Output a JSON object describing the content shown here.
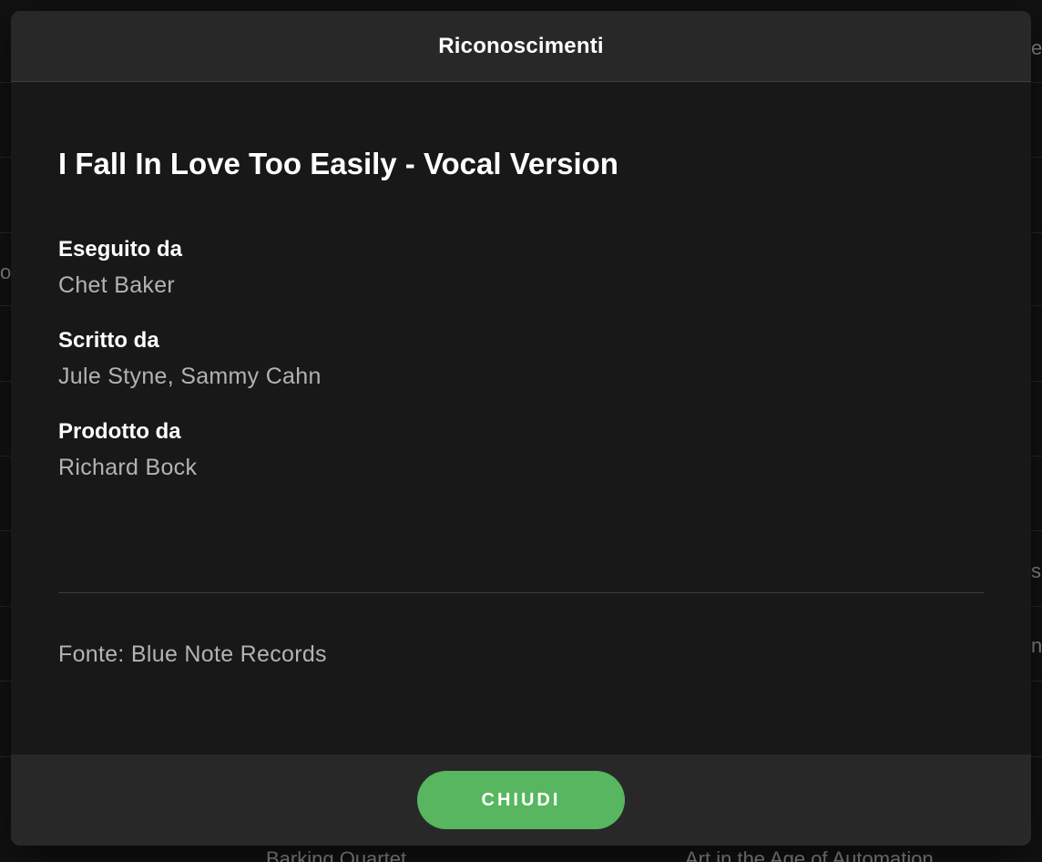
{
  "modal": {
    "title": "Riconoscimenti",
    "track_title": "I Fall In Love Too Easily - Vocal Version",
    "credits": [
      {
        "role": "Eseguito da",
        "names": "Chet Baker"
      },
      {
        "role": "Scritto da",
        "names": "Jule Styne, Sammy Cahn"
      },
      {
        "role": "Prodotto da",
        "names": "Richard Bock"
      }
    ],
    "source": "Fonte: Blue Note Records",
    "close_label": "CHIUDI"
  },
  "background": {
    "fragments": [
      "e",
      "o",
      "s",
      "n",
      "Barking Quartet",
      "Art in the Age of Automation"
    ]
  },
  "colors": {
    "accent": "#57b65f",
    "modal_bg": "#181818",
    "header_bg": "#282828",
    "secondary_text": "#b3b3b3"
  }
}
